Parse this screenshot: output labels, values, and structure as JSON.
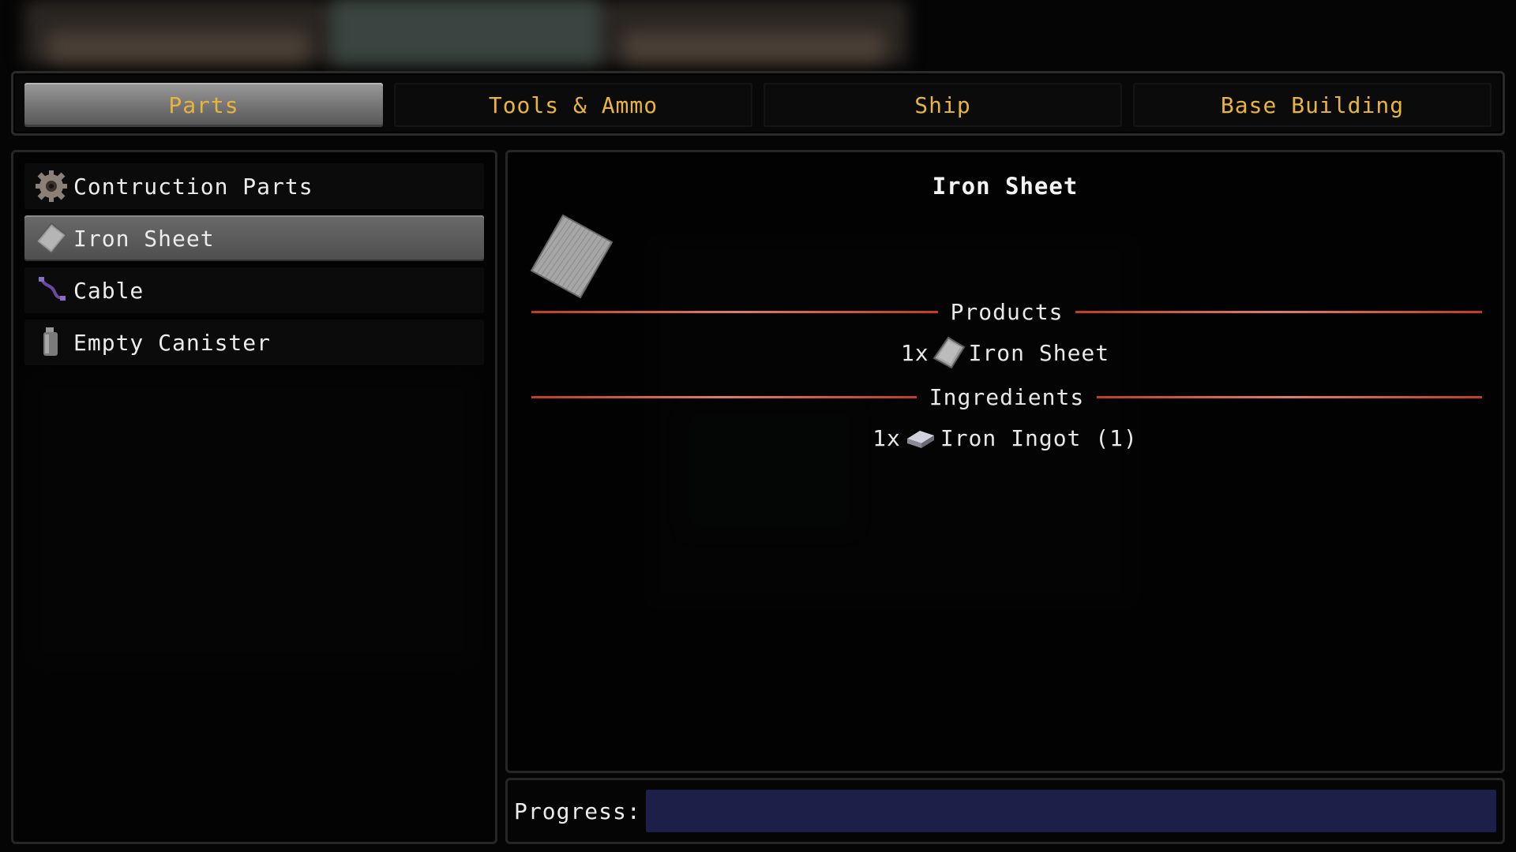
{
  "tabs": [
    {
      "label": "Parts",
      "active": true
    },
    {
      "label": "Tools & Ammo",
      "active": false
    },
    {
      "label": "Ship",
      "active": false
    },
    {
      "label": "Base Building",
      "active": false
    }
  ],
  "recipe_list": {
    "items": [
      {
        "label": "Contruction Parts",
        "icon": "gear-icon",
        "selected": false
      },
      {
        "label": "Iron Sheet",
        "icon": "iron-sheet-icon",
        "selected": true
      },
      {
        "label": "Cable",
        "icon": "cable-icon",
        "selected": false
      },
      {
        "label": "Empty Canister",
        "icon": "canister-icon",
        "selected": false
      }
    ]
  },
  "detail": {
    "title": "Iron Sheet",
    "icon": "iron-sheet-icon",
    "products_label": "Products",
    "products": [
      {
        "qty": "1x",
        "name": "Iron Sheet",
        "icon": "iron-sheet-icon"
      }
    ],
    "ingredients_label": "Ingredients",
    "ingredients": [
      {
        "qty": "1x",
        "name": "Iron Ingot (1)",
        "icon": "iron-ingot-icon"
      }
    ]
  },
  "progress": {
    "label": "Progress:",
    "value": 0
  },
  "colors": {
    "tab_text": "#e8b43a",
    "divider": "#c23b22",
    "progress_bg": "#1c1f48"
  }
}
